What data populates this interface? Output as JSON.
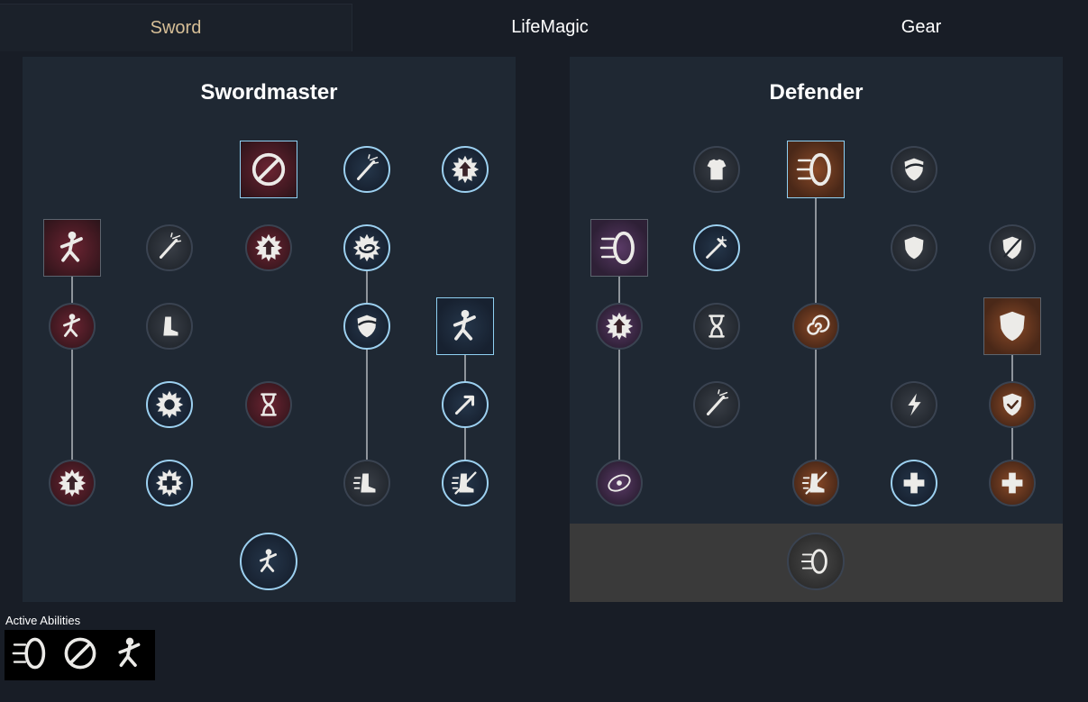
{
  "tabs": [
    {
      "label": "Sword",
      "active": true
    },
    {
      "label": "LifeMagic",
      "active": false
    },
    {
      "label": "Gear",
      "active": false
    }
  ],
  "trees": {
    "left": {
      "title": "Swordmaster",
      "accent": "#7a1e2e",
      "nodes": [
        {
          "id": "sm-r1-c3",
          "icon": "whirling-blade-icon",
          "shape": "square",
          "selected": true,
          "tone": "red"
        },
        {
          "id": "sm-r1-c4",
          "icon": "sword-strike-icon",
          "shape": "circle",
          "selected": true,
          "tone": "blue"
        },
        {
          "id": "sm-r1-c5",
          "icon": "upgrade-burst-icon",
          "shape": "circle",
          "selected": true,
          "tone": "blue"
        },
        {
          "id": "sm-r2-c1",
          "icon": "lunge-figure-icon",
          "shape": "square",
          "selected": false,
          "tone": "red"
        },
        {
          "id": "sm-r2-c2",
          "icon": "sword-sparkle-icon",
          "shape": "circle",
          "selected": false,
          "tone": "dark"
        },
        {
          "id": "sm-r2-c3",
          "icon": "upgrade-burst-icon",
          "shape": "circle",
          "selected": false,
          "tone": "red"
        },
        {
          "id": "sm-r2-c4",
          "icon": "vortex-burst-icon",
          "shape": "circle",
          "selected": true,
          "tone": "blue"
        },
        {
          "id": "sm-r3-c1",
          "icon": "charging-figure-icon",
          "shape": "circle",
          "selected": false,
          "tone": "red"
        },
        {
          "id": "sm-r3-c2",
          "icon": "boot-upgrade-icon",
          "shape": "circle",
          "selected": false,
          "tone": "dark"
        },
        {
          "id": "sm-r3-c4",
          "icon": "shield-swipe-icon",
          "shape": "circle",
          "selected": true,
          "tone": "blue"
        },
        {
          "id": "sm-r3-c5",
          "icon": "leaping-strike-icon",
          "shape": "square",
          "selected": true,
          "tone": "blue"
        },
        {
          "id": "sm-r4-c2",
          "icon": "heart-burst-icon",
          "shape": "circle",
          "selected": true,
          "tone": "blue"
        },
        {
          "id": "sm-r4-c3",
          "icon": "hourglass-down-icon",
          "shape": "circle",
          "selected": false,
          "tone": "red"
        },
        {
          "id": "sm-r4-c5",
          "icon": "arrow-strike-icon",
          "shape": "circle",
          "selected": true,
          "tone": "blue"
        },
        {
          "id": "sm-r5-c1",
          "icon": "upgrade-burst-icon",
          "shape": "circle",
          "selected": false,
          "tone": "red"
        },
        {
          "id": "sm-r5-c2",
          "icon": "health-burst-icon",
          "shape": "circle",
          "selected": true,
          "tone": "blue"
        },
        {
          "id": "sm-r5-c4",
          "icon": "speed-boot-icon",
          "shape": "circle",
          "selected": false,
          "tone": "dark"
        },
        {
          "id": "sm-r5-c5",
          "icon": "no-slow-icon",
          "shape": "circle",
          "selected": true,
          "tone": "blue"
        },
        {
          "id": "sm-ultimate",
          "icon": "triumph-figure-icon",
          "shape": "circle",
          "selected": true,
          "tone": "blue"
        }
      ]
    },
    "right": {
      "title": "Defender",
      "accent": "#7a4a2a",
      "nodes": [
        {
          "id": "df-r1-c2",
          "icon": "armor-chest-icon",
          "shape": "circle",
          "selected": false,
          "tone": "dark"
        },
        {
          "id": "df-r1-c3",
          "icon": "shield-rush-icon",
          "shape": "square",
          "selected": true,
          "tone": "orange"
        },
        {
          "id": "df-r1-c4",
          "icon": "shield-swipe-icon",
          "shape": "circle",
          "selected": false,
          "tone": "dark"
        },
        {
          "id": "df-r2-c1",
          "icon": "shield-bash-icon",
          "shape": "square",
          "selected": false,
          "tone": "purple"
        },
        {
          "id": "df-r2-c2",
          "icon": "freeze-weapon-icon",
          "shape": "circle",
          "selected": true,
          "tone": "blue"
        },
        {
          "id": "df-r2-c4",
          "icon": "shield-down-icon",
          "shape": "circle",
          "selected": false,
          "tone": "dark"
        },
        {
          "id": "df-r2-c5",
          "icon": "no-shield-icon",
          "shape": "circle",
          "selected": false,
          "tone": "dark"
        },
        {
          "id": "df-r3-c1",
          "icon": "upgrade-burst-icon",
          "shape": "circle",
          "selected": false,
          "tone": "purple"
        },
        {
          "id": "df-r3-c2",
          "icon": "hourglass-icon",
          "shape": "circle",
          "selected": false,
          "tone": "dark"
        },
        {
          "id": "df-r3-c3",
          "icon": "spiral-icon",
          "shape": "circle",
          "selected": false,
          "tone": "orange"
        },
        {
          "id": "df-r3-c5",
          "icon": "large-shield-icon",
          "shape": "square",
          "selected": false,
          "tone": "orange"
        },
        {
          "id": "df-r4-c2",
          "icon": "sword-strike-icon",
          "shape": "circle",
          "selected": false,
          "tone": "dark"
        },
        {
          "id": "df-r4-c4",
          "icon": "lightning-icon",
          "shape": "circle",
          "selected": false,
          "tone": "dark"
        },
        {
          "id": "df-r4-c5",
          "icon": "shield-check-icon",
          "shape": "circle",
          "selected": false,
          "tone": "orange"
        },
        {
          "id": "df-r5-c1",
          "icon": "orbit-stars-icon",
          "shape": "circle",
          "selected": false,
          "tone": "purple"
        },
        {
          "id": "df-r5-c3",
          "icon": "no-slow-icon",
          "shape": "circle",
          "selected": false,
          "tone": "orange"
        },
        {
          "id": "df-r5-c4",
          "icon": "healing-plus-icon",
          "shape": "circle",
          "selected": true,
          "tone": "blue"
        },
        {
          "id": "df-r5-c5",
          "icon": "health-cross-icon",
          "shape": "circle",
          "selected": false,
          "tone": "orange"
        },
        {
          "id": "df-ultimate",
          "icon": "shield-spin-icon",
          "shape": "circle",
          "selected": false,
          "tone": "grey"
        }
      ]
    }
  },
  "active_abilities": {
    "label": "Active Abilities",
    "items": [
      {
        "icon": "shield-rush-icon"
      },
      {
        "icon": "whirling-blade-icon"
      },
      {
        "icon": "leaping-strike-icon"
      }
    ]
  },
  "colors": {
    "background": "#181d26",
    "panel": "#1f2833",
    "active_tab_text": "#d7bf97",
    "selected_border": "#9cd0f0"
  }
}
